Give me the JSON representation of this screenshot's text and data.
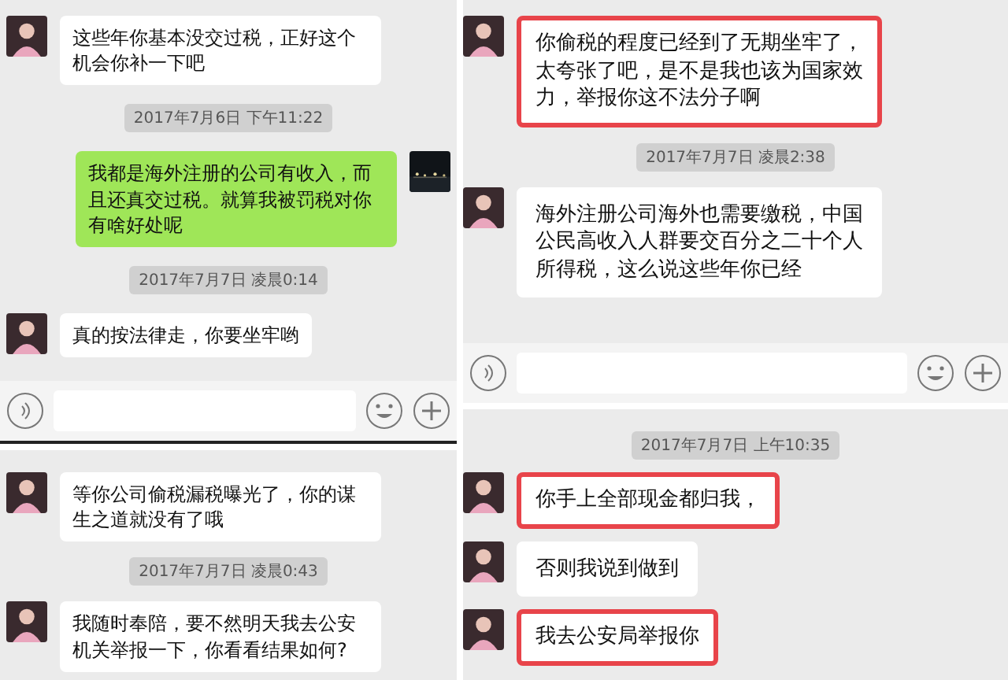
{
  "panels": [
    {
      "input_bar": true,
      "messages": [
        {
          "kind": "received",
          "text": "这些年你基本没交过税，正好这个机会你补一下吧",
          "highlighted": false
        },
        {
          "kind": "timestamp",
          "text": "2017年7月6日 下午11:22"
        },
        {
          "kind": "sent",
          "text": "我都是海外注册的公司有收入，而且还真交过税。就算我被罚税对你有啥好处呢",
          "highlighted": false
        },
        {
          "kind": "timestamp",
          "text": "2017年7月7日 凌晨0:14"
        },
        {
          "kind": "received",
          "text": "真的按法律走，你要坐牢哟",
          "highlighted": false
        }
      ]
    },
    {
      "messages": [
        {
          "kind": "received",
          "text": "等你公司偷税漏税曝光了，你的谋生之道就没有了哦",
          "highlighted": false
        },
        {
          "kind": "timestamp",
          "text": "2017年7月7日 凌晨0:43"
        },
        {
          "kind": "received",
          "text": "我随时奉陪，要不然明天我去公安机关举报一下，你看看结果如何?",
          "highlighted": false
        }
      ]
    },
    {
      "input_bar": true,
      "messages": [
        {
          "kind": "received",
          "text": "你偷税的程度已经到了无期坐牢了，太夸张了吧，是不是我也该为国家效力，举报你这不法分子啊",
          "highlighted": true
        },
        {
          "kind": "timestamp",
          "text": "2017年7月7日 凌晨2:38"
        },
        {
          "kind": "received",
          "text": "海外注册公司海外也需要缴税，中国公民高收入人群要交百分之二十个人所得税，这么说这些年你已经",
          "highlighted": false
        }
      ]
    },
    {
      "messages": [
        {
          "kind": "timestamp",
          "text": "2017年7月7日 上午10:35"
        },
        {
          "kind": "received",
          "text": "你手上全部现金都归我，",
          "highlighted": true
        },
        {
          "kind": "received",
          "text": "否则我说到做到",
          "highlighted": false
        },
        {
          "kind": "received",
          "text": "我去公安局举报你",
          "highlighted": true
        }
      ]
    }
  ]
}
